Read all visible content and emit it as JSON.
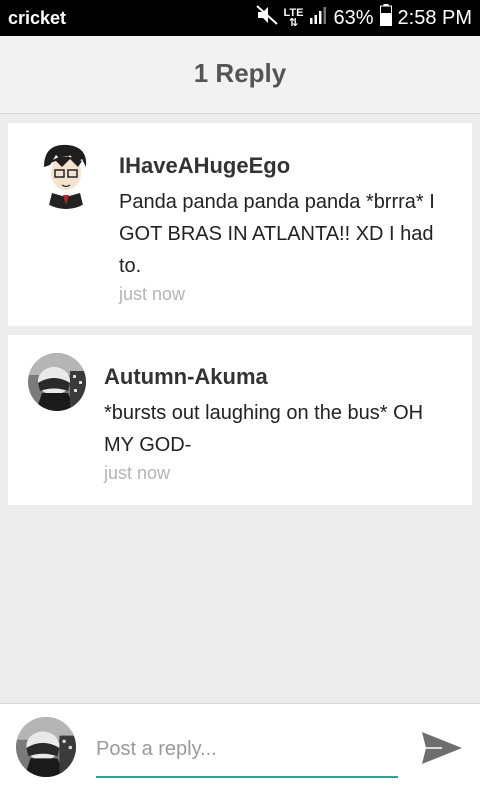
{
  "status_bar": {
    "carrier": "cricket",
    "network": "LTE",
    "battery": "63%",
    "time": "2:58 PM",
    "icons": [
      "mute-icon",
      "lte-icon",
      "signal-icon",
      "battery-icon"
    ]
  },
  "header": {
    "title": "1 Reply"
  },
  "comments": [
    {
      "username": "IHaveAHugeEgo",
      "text": "Panda panda panda panda *brrra* I GOT BRAS IN ATLANTA!! XD I had to.",
      "time": "just now"
    },
    {
      "username": "Autumn-Akuma",
      "text": "*bursts out laughing on the bus* OH MY GOD-",
      "time": "just now"
    }
  ],
  "reply": {
    "placeholder": "Post a reply...",
    "value": ""
  },
  "colors": {
    "accent": "#2aa59a",
    "background": "#ececec",
    "status_bar": "#000000",
    "timestamp": "#b4b4b4"
  }
}
